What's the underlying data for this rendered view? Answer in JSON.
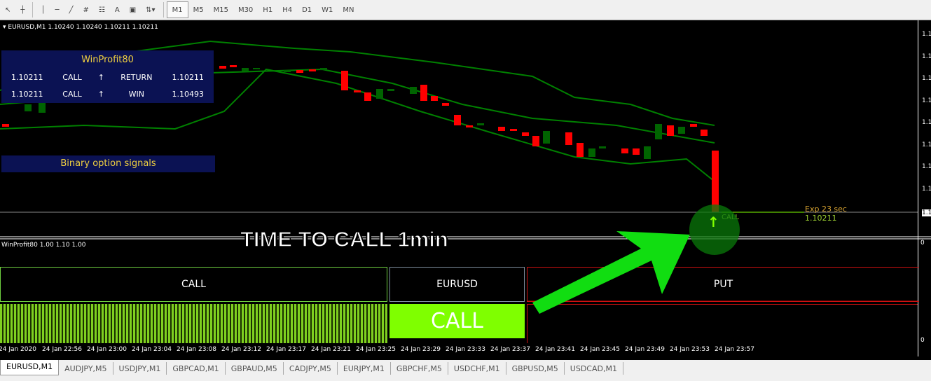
{
  "toolbar": {
    "icons": [
      "cursor-icon",
      "crosshair-icon",
      "vertical-line-icon",
      "horizontal-line-icon",
      "trendline-icon",
      "fibonacci-icon",
      "fibonacci-fan-icon",
      "text-icon",
      "text-label-icon",
      "arrows-icon"
    ],
    "text_A": "A",
    "timeframes": [
      "M1",
      "M5",
      "M15",
      "M30",
      "H1",
      "H4",
      "D1",
      "W1",
      "MN"
    ],
    "active_timeframe": "M1"
  },
  "chart": {
    "header": "EURUSD,M1  1.10240 1.10240 1.10211 1.10211",
    "panel": {
      "title": "WinProfit80",
      "rows": [
        {
          "price": "1.10211",
          "signal": "CALL",
          "arrow": "↑",
          "label": "RETURN",
          "value": "1.10211"
        },
        {
          "price": "1.10211",
          "signal": "CALL",
          "arrow": "↑",
          "label": "WIN",
          "value": "1.10493"
        }
      ]
    },
    "signals_label": "Binary option signals",
    "overlay_text": "TIME TO CALL 1min",
    "exp_label": "Exp 23 sec",
    "exp_price": "1.10211",
    "call_marker": "CALL",
    "call_arrow": "↑",
    "price_labels": [
      "1.1",
      "1.1",
      "1.1",
      "1.1",
      "1.1",
      "1.1",
      "1.1",
      "1.1",
      "1.1"
    ],
    "colors": {
      "bull": "#006400",
      "bear": "#ff0000",
      "bands": "#008000",
      "panel": "#0b1253",
      "accent": "#7fff00"
    }
  },
  "indicator": {
    "label": "WinProfit80  1.00 1.10 1.00",
    "call_button": "CALL",
    "symbol": "EURUSD",
    "put_button": "PUT",
    "signal": "CALL",
    "scale_top": "0",
    "scale_bottom": "0"
  },
  "time_axis": [
    "24 Jan 2020",
    "24 Jan 22:56",
    "24 Jan 23:00",
    "24 Jan 23:04",
    "24 Jan 23:08",
    "24 Jan 23:12",
    "24 Jan 23:17",
    "24 Jan 23:21",
    "24 Jan 23:25",
    "24 Jan 23:29",
    "24 Jan 23:33",
    "24 Jan 23:37",
    "24 Jan 23:41",
    "24 Jan 23:45",
    "24 Jan 23:49",
    "24 Jan 23:53",
    "24 Jan 23:57"
  ],
  "tabs": [
    "EURUSD,M1",
    "AUDJPY,M5",
    "USDJPY,M1",
    "GBPCAD,M1",
    "GBPAUD,M5",
    "CADJPY,M5",
    "EURJPY,M1",
    "GBPCHF,M5",
    "USDCHF,M1",
    "GBPUSD,M5",
    "USDCAD,M1"
  ],
  "active_tab": "EURUSD,M1"
}
